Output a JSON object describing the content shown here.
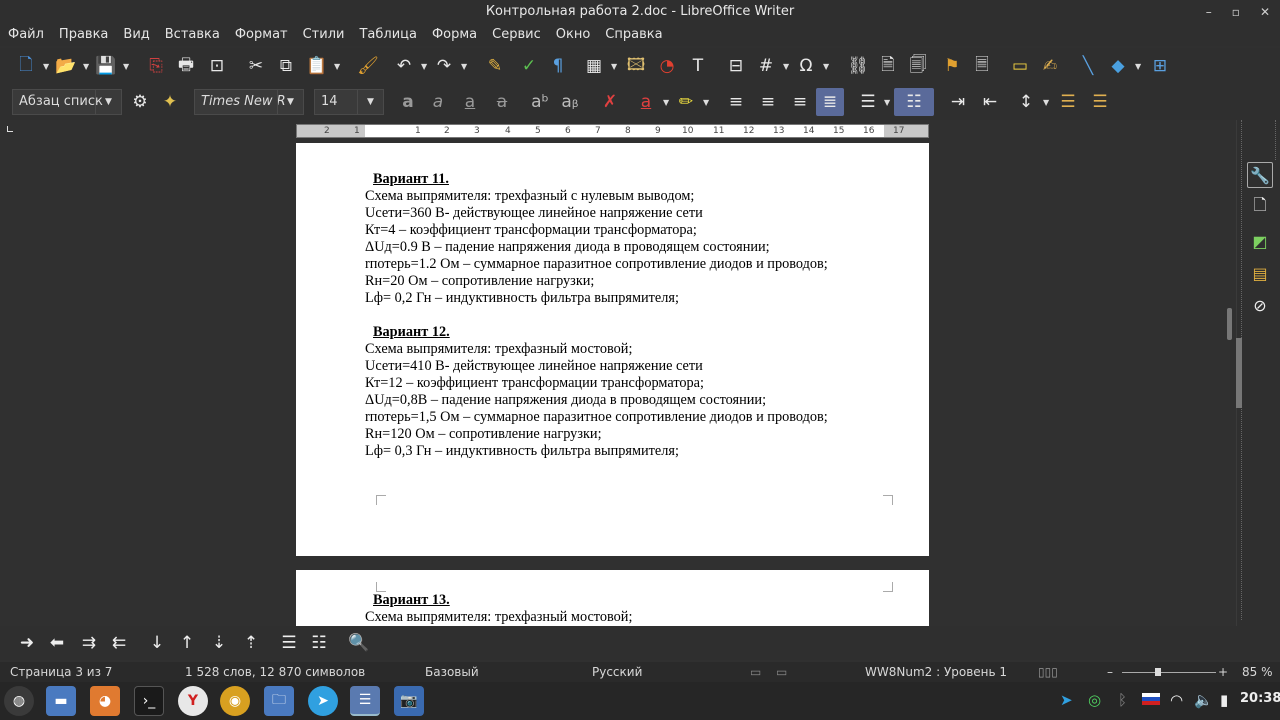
{
  "window": {
    "title": "Контрольная работа 2.doc - LibreOffice Writer"
  },
  "menu": [
    "Файл",
    "Правка",
    "Вид",
    "Вставка",
    "Формат",
    "Стили",
    "Таблица",
    "Форма",
    "Сервис",
    "Окно",
    "Справка"
  ],
  "formatting": {
    "paragraph_style": "Абзац списк",
    "font_name": "Times New R",
    "font_size": "14"
  },
  "ruler": [
    "2",
    "1",
    "1",
    "2",
    "3",
    "4",
    "5",
    "6",
    "7",
    "8",
    "9",
    "10",
    "11",
    "12",
    "13",
    "14",
    "15",
    "16",
    "17"
  ],
  "document": {
    "variant11": {
      "heading": "Вариант 11.",
      "lines": [
        "Схема выпрямителя: трехфазный с нулевым выводом;",
        "Uсети=360 В- действующее линейное напряжение сети",
        "Кт=4 – коэффициент трансформации трансформатора;",
        "ΔUд=0.9 В – падение напряжения диода в проводящем состоянии;",
        "rпотерь=1.2 Ом – суммарное паразитное сопротивление диодов и проводов;",
        "Rн=20 Ом – сопротивление нагрузки;",
        "Lф= 0,2 Гн – индуктивность фильтра выпрямителя;"
      ]
    },
    "variant12": {
      "heading": "Вариант 12.",
      "lines": [
        "Схема выпрямителя: трехфазный мостовой;",
        "Uсети=410 В- действующее линейное напряжение сети",
        "Кт=12 – коэффициент трансформации трансформатора;",
        "ΔUд=0,8В – падение напряжения диода в проводящем состоянии;",
        "rпотерь=1,5 Ом – суммарное паразитное сопротивление диодов и проводов;",
        "Rн=120 Ом – сопротивление нагрузки;",
        "Lф= 0,3 Гн – индуктивность фильтра выпрямителя;"
      ]
    },
    "variant13": {
      "heading": "Вариант 13.",
      "lines": [
        "Схема выпрямителя: трехфазный мостовой;"
      ]
    }
  },
  "status": {
    "page": "Страница 3 из 7",
    "words": "1 528 слов, 12 870 символов",
    "style": "Базовый",
    "language": "Русский",
    "list": "WW8Num2 : Уровень 1",
    "zoom": "85 %"
  },
  "taskbar": {
    "clock": "20:38"
  },
  "icons": {
    "toolbar1": [
      "new-icon",
      "open-icon",
      "save-icon",
      "export-pdf-icon",
      "print-icon",
      "print-preview-icon",
      "cut-icon",
      "copy-icon",
      "paste-icon",
      "clone-format-icon",
      "undo-icon",
      "redo-icon",
      "spelling-icon",
      "autospell-icon",
      "formatting-marks-icon",
      "table-icon",
      "image-icon",
      "chart-icon",
      "textbox-icon",
      "page-break-icon",
      "field-icon",
      "special-char-icon",
      "hyperlink-icon",
      "footnote-icon",
      "endnote-icon",
      "bookmark-icon",
      "cross-ref-icon",
      "comment-icon",
      "track-changes-icon",
      "line-icon",
      "shapes-icon",
      "sidebar-icon"
    ]
  }
}
